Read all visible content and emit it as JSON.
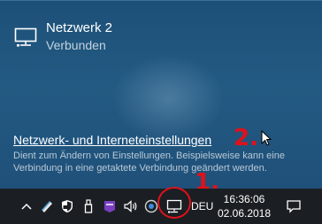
{
  "flyout": {
    "network_name": "Netzwerk  2",
    "network_status": "Verbunden",
    "settings_link": "Netzwerk- und Interneteinstellungen",
    "settings_description": "Dient zum Ändern von Einstellungen. Beispielsweise kann eine Verbindung in eine getaktete Verbindung geändert werden."
  },
  "annotations": {
    "step1": "1.",
    "step2": "2.",
    "color": "#e0111a"
  },
  "taskbar": {
    "tray_icons": [
      "chevron-up-icon",
      "pen-tablet-icon",
      "shield-icon",
      "usb-icon",
      "app-icon",
      "volume-icon",
      "sync-icon",
      "network-icon"
    ],
    "language": "DEU",
    "time": "16:36:06",
    "date": "02.06.2018"
  },
  "colors": {
    "flyout_background": "#235a83",
    "taskbar_background": "#1b1f23",
    "text": "#ffffff"
  }
}
